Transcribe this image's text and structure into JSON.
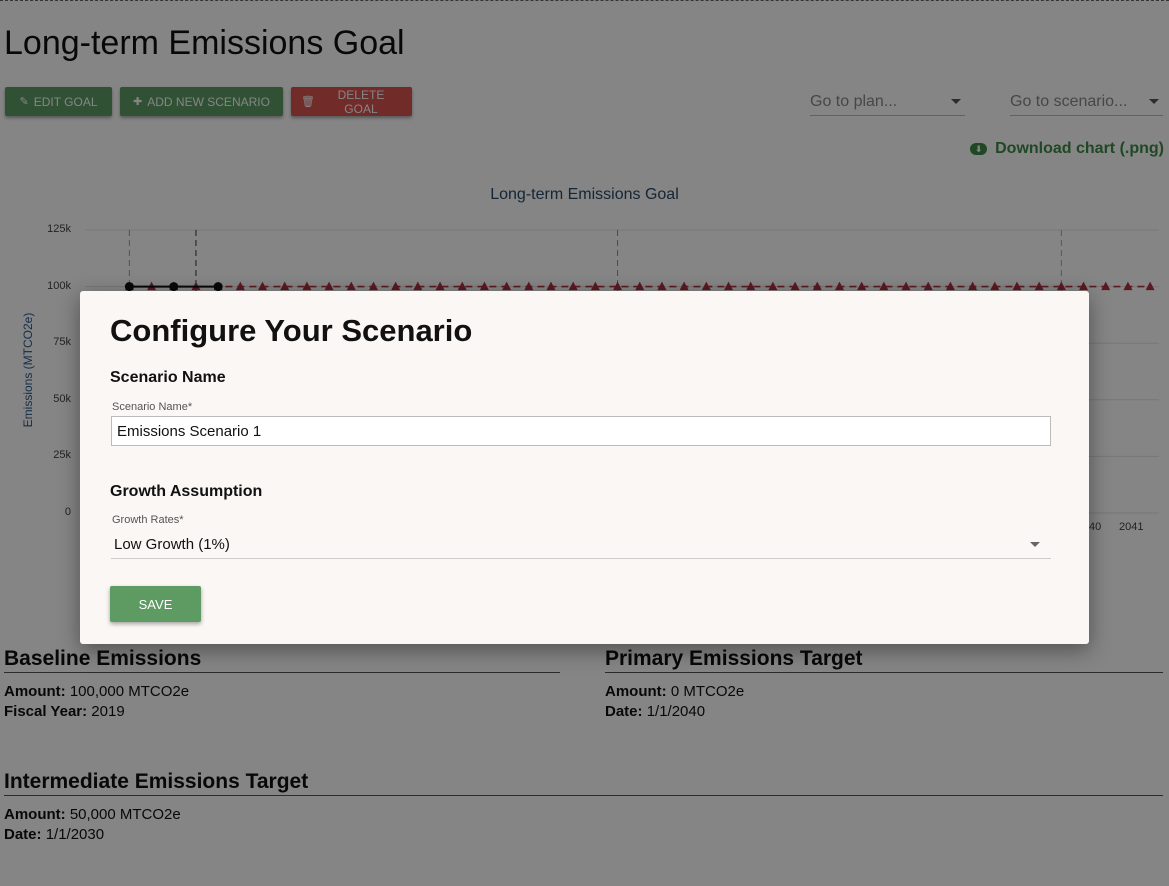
{
  "page": {
    "title": "Long-term Emissions Goal"
  },
  "toolbar": {
    "edit_goal": "EDIT GOAL",
    "add_scenario": "ADD NEW SCENARIO",
    "delete_goal": "DELETE GOAL",
    "plan_placeholder": "Go to plan...",
    "scenario_placeholder": "Go to scenario...",
    "download": "Download chart (.png)"
  },
  "colors": {
    "primary_green": "#5d9b62",
    "danger_red": "#d9534f",
    "download_green": "#3e8a48",
    "target_line": "#b03040"
  },
  "chart_data": {
    "type": "line",
    "title": "Long-term Emissions Goal",
    "ylabel": "Emissions (MTCO2e)",
    "ylim": [
      0,
      125000
    ],
    "y_ticks": [
      "125k",
      "100k",
      "75k",
      "50k",
      "25k",
      "0"
    ],
    "x_ticks_visible": [
      "40",
      "2041"
    ],
    "series": [
      {
        "type": "line",
        "style": "dashed",
        "color": "#b03040",
        "marker": "triangle",
        "x": [
          2019,
          2019.5,
          2020,
          2020.5,
          2021,
          2021.5,
          2022,
          2022.5,
          2023,
          2023.5,
          2024,
          2024.5,
          2025,
          2025.5,
          2026,
          2026.5,
          2027,
          2027.5,
          2028,
          2028.5,
          2029,
          2029.5,
          2030,
          2030.5,
          2031,
          2031.5,
          2032,
          2032.5,
          2033,
          2033.5,
          2034,
          2034.5,
          2035,
          2035.5,
          2036,
          2036.5,
          2037,
          2037.5,
          2038,
          2038.5,
          2039,
          2039.5,
          2040,
          2040.5,
          2041,
          2041.5,
          2042
        ],
        "y": [
          100000,
          100000,
          100000,
          100000,
          100000,
          100000,
          100000,
          100000,
          100000,
          100000,
          100000,
          100000,
          100000,
          100000,
          100000,
          100000,
          100000,
          100000,
          100000,
          100000,
          100000,
          100000,
          100000,
          100000,
          100000,
          100000,
          100000,
          100000,
          100000,
          100000,
          100000,
          100000,
          100000,
          100000,
          100000,
          100000,
          100000,
          100000,
          100000,
          100000,
          100000,
          100000,
          100000,
          100000,
          100000,
          100000,
          100000
        ]
      },
      {
        "type": "line",
        "style": "solid",
        "color": "#111111",
        "marker": "circle",
        "x": [
          2019,
          2020,
          2021
        ],
        "y": [
          100000,
          100000,
          100000
        ]
      }
    ],
    "reference_lines": [
      {
        "x": 2019,
        "color": "#c09080",
        "style": "dashed"
      },
      {
        "x": 2020.5,
        "color": "#333333",
        "style": "dashed"
      },
      {
        "x": 2030,
        "color": "#d08040",
        "style": "dashed"
      },
      {
        "x": 2040,
        "color": "#aaaaaa",
        "style": "dashed"
      }
    ],
    "grid": true
  },
  "baseline": {
    "heading": "Baseline Emissions",
    "amount_label": "Amount:",
    "amount_value": "100,000 MTCO2e",
    "year_label": "Fiscal Year:",
    "year_value": "2019"
  },
  "primary_target": {
    "heading": "Primary Emissions Target",
    "amount_label": "Amount:",
    "amount_value": "0 MTCO2e",
    "date_label": "Date:",
    "date_value": "1/1/2040"
  },
  "intermediate_target": {
    "heading": "Intermediate Emissions Target",
    "amount_label": "Amount:",
    "amount_value": "50,000 MTCO2e",
    "date_label": "Date:",
    "date_value": "1/1/2030"
  },
  "modal": {
    "title": "Configure Your Scenario",
    "name_section": "Scenario Name",
    "name_label": "Scenario Name",
    "name_value": "Emissions Scenario 1",
    "growth_section": "Growth Assumption",
    "growth_label": "Growth Rates",
    "growth_value": "Low Growth (1%)",
    "required_mark": "*",
    "save": "SAVE"
  }
}
